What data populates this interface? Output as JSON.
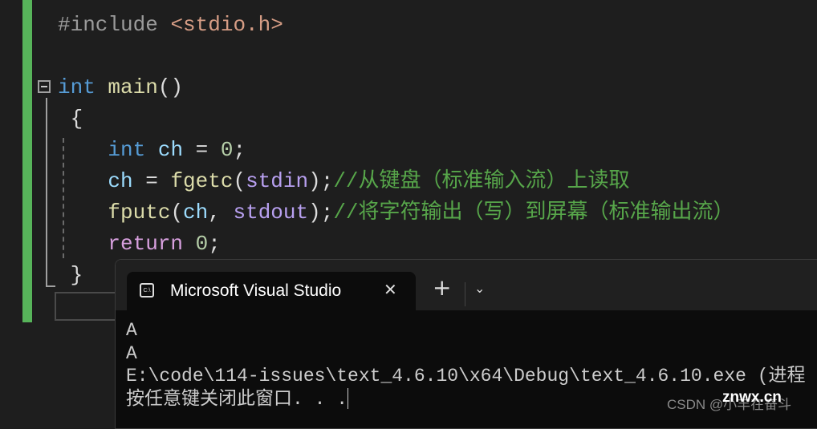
{
  "editor": {
    "lines": [
      {
        "parts": [
          {
            "t": "#include ",
            "c": "pp"
          },
          {
            "t": "<stdio.h>",
            "c": "str"
          }
        ]
      },
      {
        "parts": []
      },
      {
        "parts": [
          {
            "t": "int",
            "c": "kw"
          },
          {
            "t": " ",
            "c": ""
          },
          {
            "t": "main",
            "c": "fn"
          },
          {
            "t": "()",
            "c": ""
          }
        ]
      },
      {
        "parts": [
          {
            "t": " {",
            "c": ""
          }
        ]
      },
      {
        "parts": [
          {
            "t": "    ",
            "c": ""
          },
          {
            "t": "int",
            "c": "kw"
          },
          {
            "t": " ",
            "c": ""
          },
          {
            "t": "ch",
            "c": "var"
          },
          {
            "t": " = ",
            "c": ""
          },
          {
            "t": "0",
            "c": "num"
          },
          {
            "t": ";",
            "c": ""
          }
        ]
      },
      {
        "parts": [
          {
            "t": "    ",
            "c": ""
          },
          {
            "t": "ch",
            "c": "var"
          },
          {
            "t": " = ",
            "c": ""
          },
          {
            "t": "fgetc",
            "c": "fn"
          },
          {
            "t": "(",
            "c": ""
          },
          {
            "t": "stdin",
            "c": "glob"
          },
          {
            "t": ");",
            "c": ""
          },
          {
            "t": "//从键盘（标准输入流）上读取",
            "c": "cm"
          }
        ]
      },
      {
        "parts": [
          {
            "t": "    ",
            "c": ""
          },
          {
            "t": "fputc",
            "c": "fn"
          },
          {
            "t": "(",
            "c": ""
          },
          {
            "t": "ch",
            "c": "var"
          },
          {
            "t": ", ",
            "c": ""
          },
          {
            "t": "stdout",
            "c": "glob"
          },
          {
            "t": ");",
            "c": ""
          },
          {
            "t": "//将字符输出（写）到屏幕（标准输出流）",
            "c": "cm"
          }
        ]
      },
      {
        "parts": [
          {
            "t": "    ",
            "c": ""
          },
          {
            "t": "return",
            "c": "ret"
          },
          {
            "t": " ",
            "c": ""
          },
          {
            "t": "0",
            "c": "num"
          },
          {
            "t": ";",
            "c": ""
          }
        ]
      },
      {
        "parts": [
          {
            "t": " }",
            "c": ""
          }
        ]
      }
    ]
  },
  "terminal": {
    "tab_title": "Microsoft Visual Studio",
    "tab_icon": "console-icon",
    "close_label": "✕",
    "new_tab_label": "+",
    "dropdown_label": "⌄",
    "output": [
      "A",
      "A",
      "E:\\code\\114-issues\\text_4.6.10\\x64\\Debug\\text_4.6.10.exe (进程",
      "按任意键关闭此窗口. . ."
    ]
  },
  "watermark": {
    "csdn": "CSDN @小丰在奋斗",
    "site": "znwx.cn"
  }
}
